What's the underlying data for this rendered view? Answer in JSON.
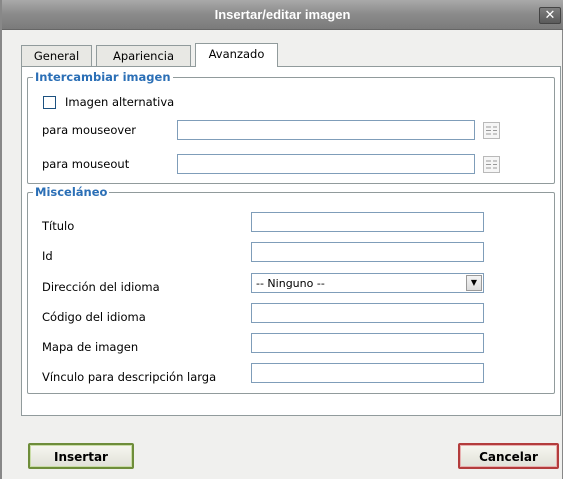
{
  "window": {
    "title": "Insertar/editar imagen",
    "close_glyph": "✕"
  },
  "tabs": [
    {
      "label": "General",
      "active": false
    },
    {
      "label": "Apariencia",
      "active": false
    },
    {
      "label": "Avanzado",
      "active": true
    }
  ],
  "swap_group": {
    "legend": "Intercambiar imagen",
    "alt_image_label": "Imagen alternativa",
    "alt_image_checked": false,
    "mouseover_label": "para mouseover",
    "mouseover_value": "",
    "mouseout_label": "para mouseout",
    "mouseout_value": "",
    "browse_icon": "browse-icon"
  },
  "misc_group": {
    "legend": "Misceláneo",
    "title_label": "Título",
    "title_value": "",
    "id_label": "Id",
    "id_value": "",
    "dir_label": "Dirección del idioma",
    "dir_value": "-- Ninguno --",
    "lang_label": "Código del idioma",
    "lang_value": "",
    "map_label": "Mapa de imagen",
    "map_value": "",
    "longdesc_label": "Vínculo para descripción larga",
    "longdesc_value": ""
  },
  "buttons": {
    "insert": "Insertar",
    "cancel": "Cancelar"
  },
  "colors": {
    "legend": "#2b6fb6",
    "insert_border": "#6e8d3a",
    "cancel_border": "#b33c3c",
    "titlebar": "#8a8a8a"
  }
}
